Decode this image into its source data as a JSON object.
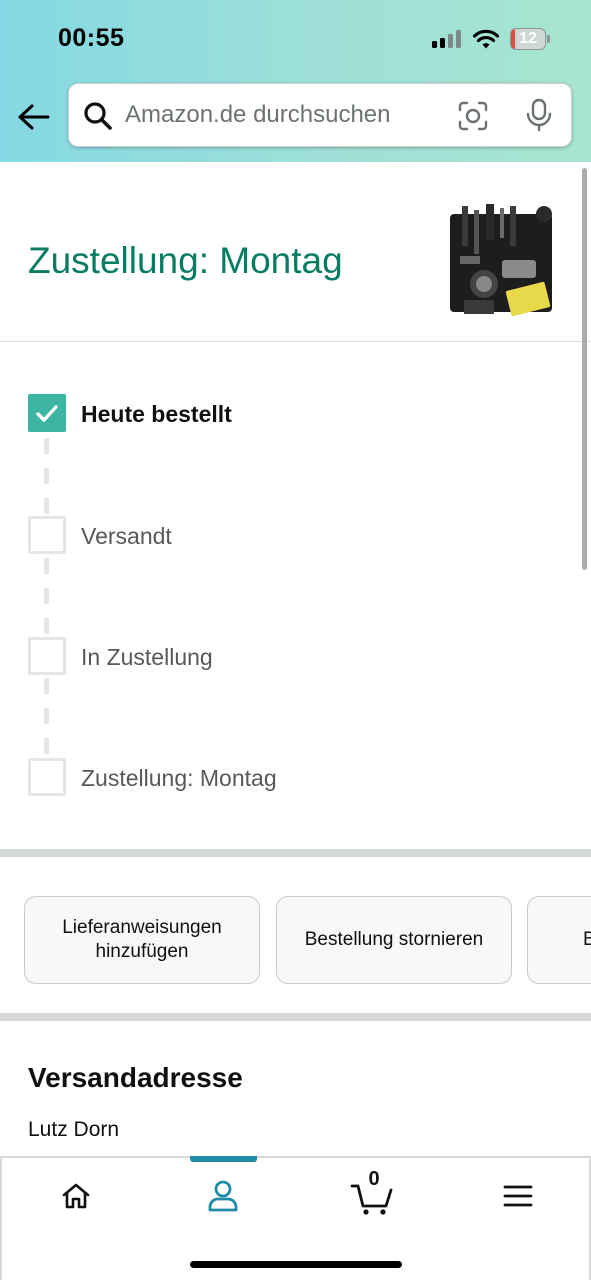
{
  "status_bar": {
    "time": "00:55",
    "battery_level": "12",
    "battery_fraction": 0.12,
    "battery_color": "#e34a3c"
  },
  "search": {
    "placeholder": "Amazon.de durchsuchen",
    "icons": [
      "back-arrow-icon",
      "search-icon",
      "camera-icon",
      "microphone-icon"
    ]
  },
  "delivery": {
    "title": "Zustellung: Montag",
    "accent_color": "#067d62"
  },
  "timeline": {
    "check_color": "#3db5a2",
    "steps": [
      {
        "label": "Heute bestellt",
        "done": true
      },
      {
        "label": "Versandt",
        "done": false
      },
      {
        "label": "In Zustellung",
        "done": false
      },
      {
        "label": "Zustellung: Montag",
        "done": false
      }
    ]
  },
  "actions": [
    {
      "label": "Lieferanweisungen hinzufügen"
    },
    {
      "label": "Bestellung stornieren"
    },
    {
      "label": "B"
    }
  ],
  "shipping": {
    "section_title": "Versandadresse",
    "name": "Lutz Dorn"
  },
  "bottom_nav": {
    "items": [
      "home-icon",
      "account-icon",
      "cart-icon",
      "menu-icon"
    ],
    "active": "account-icon",
    "cart_count": "0",
    "active_color": "#1f8aa6"
  }
}
